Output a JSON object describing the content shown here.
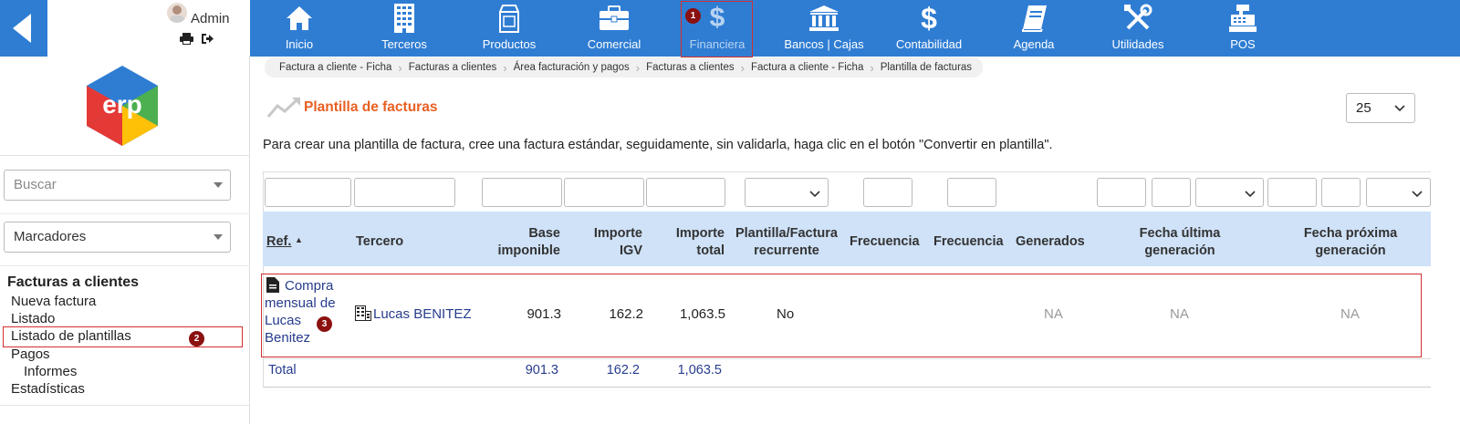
{
  "user": {
    "name": "Admin"
  },
  "nav": [
    {
      "label": "Inicio",
      "icon": "home-icon"
    },
    {
      "label": "Terceros",
      "icon": "building-icon"
    },
    {
      "label": "Productos",
      "icon": "product-box-icon"
    },
    {
      "label": "Comercial",
      "icon": "briefcase-icon"
    },
    {
      "label": "Financiera",
      "icon": "dollar-icon"
    },
    {
      "label": "Bancos | Cajas",
      "icon": "bank-icon"
    },
    {
      "label": "Contabilidad",
      "icon": "dollar-icon"
    },
    {
      "label": "Agenda",
      "icon": "book-icon"
    },
    {
      "label": "Utilidades",
      "icon": "tools-icon"
    },
    {
      "label": "POS",
      "icon": "cash-register-icon"
    }
  ],
  "annotations": {
    "b1": "1",
    "b2": "2",
    "b3": "3"
  },
  "sidebar": {
    "search_placeholder": "Buscar",
    "bookmarks_label": "Marcadores",
    "menu_title": "Facturas a clientes",
    "menu_items": [
      "Nueva factura",
      "Listado",
      "Listado de plantillas",
      "Pagos",
      "Informes",
      "Estadísticas"
    ]
  },
  "breadcrumb": [
    "Factura a cliente - Ficha",
    "Facturas a clientes",
    "Área facturación y pagos",
    "Facturas a clientes",
    "Factura a cliente - Ficha",
    "Plantilla de facturas"
  ],
  "page": {
    "title": "Plantilla de facturas",
    "limit": "25",
    "info": "Para crear una plantilla de factura, cree una factura estándar, seguidamente, sin validarla, haga clic en el botón \"Convertir en plantilla\"."
  },
  "table": {
    "headers": {
      "ref": "Ref.",
      "tercero": "Tercero",
      "base_1": "Base",
      "base_2": "imponible",
      "igv_1": "Importe",
      "igv_2": "IGV",
      "total_1": "Importe",
      "total_2": "total",
      "rec_1": "Plantilla/Factura",
      "rec_2": "recurrente",
      "freq1": "Frecuencia",
      "freq2": "Frecuencia",
      "generados": "Generados",
      "last_1": "Fecha última",
      "last_2": "generación",
      "next_1": "Fecha próxima",
      "next_2": "generación"
    },
    "row": {
      "ref": "Compra mensual de Lucas Benitez",
      "tercero": "Lucas BENITEZ",
      "base": "901.3",
      "igv": "162.2",
      "total": "1,063.5",
      "recurrente": "No",
      "generados": "NA",
      "last": "NA",
      "next": "NA"
    },
    "totals": {
      "label": "Total",
      "base": "901.3",
      "igv": "162.2",
      "total": "1,063.5"
    }
  },
  "colors": {
    "topbar": "#2f7dd3",
    "title": "#e85f22",
    "header_bg": "#cfe2f8",
    "link": "#263c8c",
    "highlight": "#d32f2f"
  }
}
